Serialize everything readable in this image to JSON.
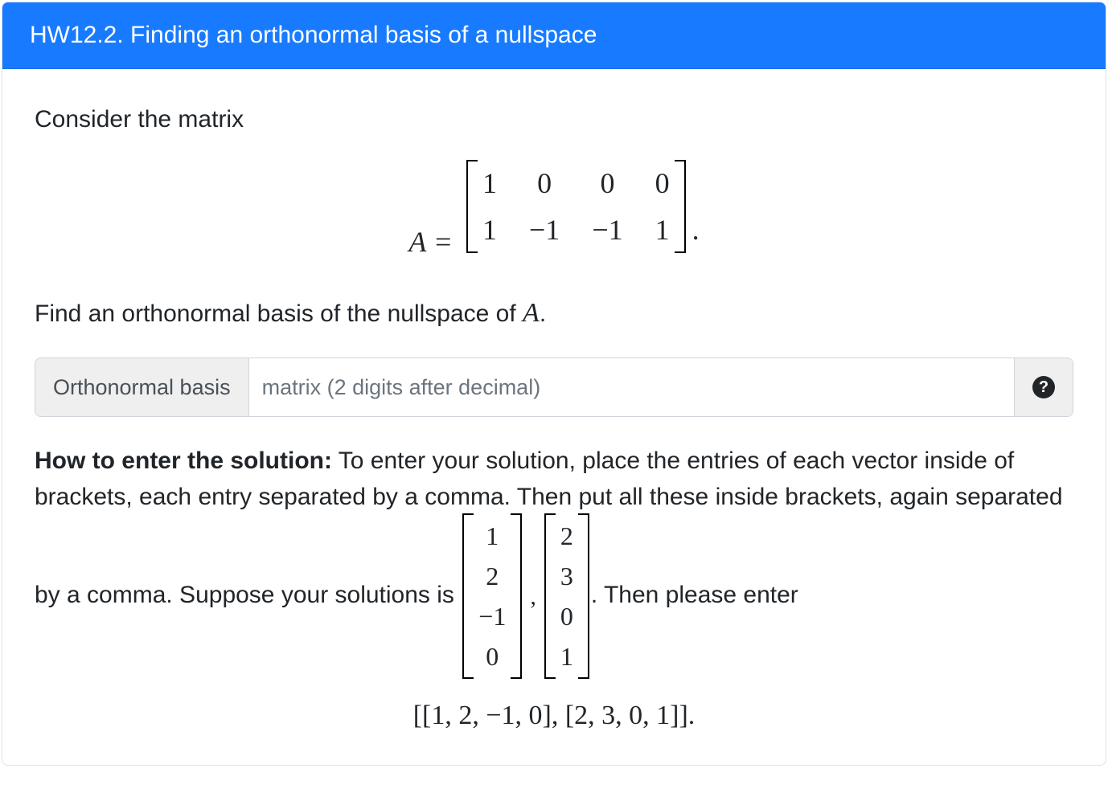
{
  "header": {
    "title": "HW12.2. Finding an orthonormal basis of a nullspace"
  },
  "body": {
    "intro": "Consider the matrix",
    "matrix_label": "A =",
    "matrix": {
      "r1c1": "1",
      "r1c2": "0",
      "r1c3": "0",
      "r1c4": "0",
      "r2c1": "1",
      "r2c2": "−1",
      "r2c3": "−1",
      "r2c4": "1"
    },
    "matrix_period": ".",
    "find_part1": "Find an orthonormal basis of the nullspace of ",
    "A_symbol": "A",
    "find_period": "."
  },
  "input": {
    "label": "Orthonormal basis",
    "placeholder": "matrix (2 digits after decimal)",
    "value": "",
    "help_symbol": "?"
  },
  "instructions": {
    "bold": "How to enter the solution:",
    "text1": " To enter your solution, place the entries of each vector inside of brackets, each entry separated by a comma. Then put all these inside brackets, again separated by a comma. Suppose your solutions is ",
    "vec1": {
      "a": "1",
      "b": "2",
      "c": "−1",
      "d": "0"
    },
    "sep": ",",
    "vec2": {
      "a": "2",
      "b": "3",
      "c": "0",
      "d": "1"
    },
    "text2": ". Then please enter",
    "final": "[[1, 2, −1, 0], [2, 3, 0, 1]]."
  }
}
